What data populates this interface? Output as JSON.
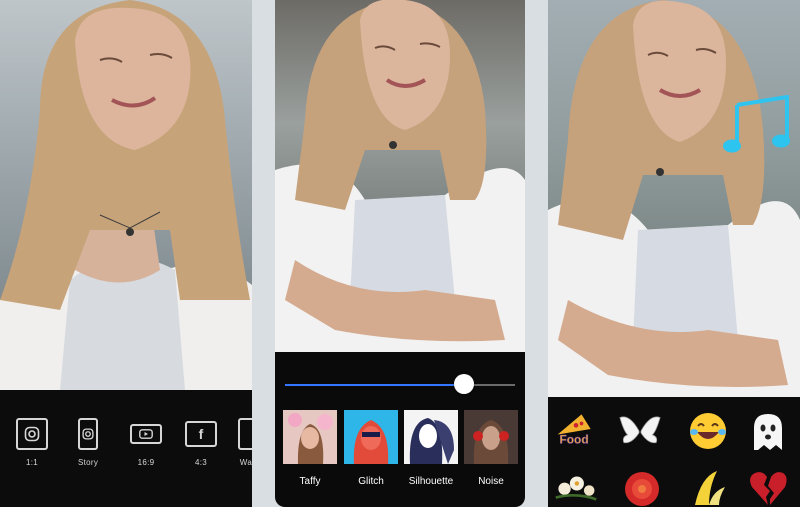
{
  "crop_toolbar": {
    "ratios": [
      {
        "label": "1:1",
        "icon": "instagram-square-icon"
      },
      {
        "label": "Story",
        "icon": "instagram-story-icon"
      },
      {
        "label": "16:9",
        "icon": "youtube-icon"
      },
      {
        "label": "4:3",
        "icon": "facebook-icon"
      },
      {
        "label": "Wall",
        "icon": "wallpaper-icon"
      }
    ]
  },
  "filter_toolbar": {
    "intensity": 0.78,
    "accent_color": "#3477ff",
    "filters": [
      {
        "label": "Taffy"
      },
      {
        "label": "Glitch"
      },
      {
        "label": "Silhouette"
      },
      {
        "label": "Noise"
      }
    ]
  },
  "sticker_toolbar": {
    "stickers": [
      {
        "icon": "food-text-sticker-icon"
      },
      {
        "icon": "angel-wings-sticker-icon"
      },
      {
        "icon": "laughing-emoji-icon"
      },
      {
        "icon": "ghost-emoji-icon"
      },
      {
        "icon": "flowers-sticker-icon"
      },
      {
        "icon": "red-flower-sticker-icon"
      },
      {
        "icon": "banana-sticker-icon"
      },
      {
        "icon": "broken-heart-icon"
      }
    ],
    "overlay_icon": "music-note-icon",
    "overlay_color": "#2ec4f0"
  }
}
